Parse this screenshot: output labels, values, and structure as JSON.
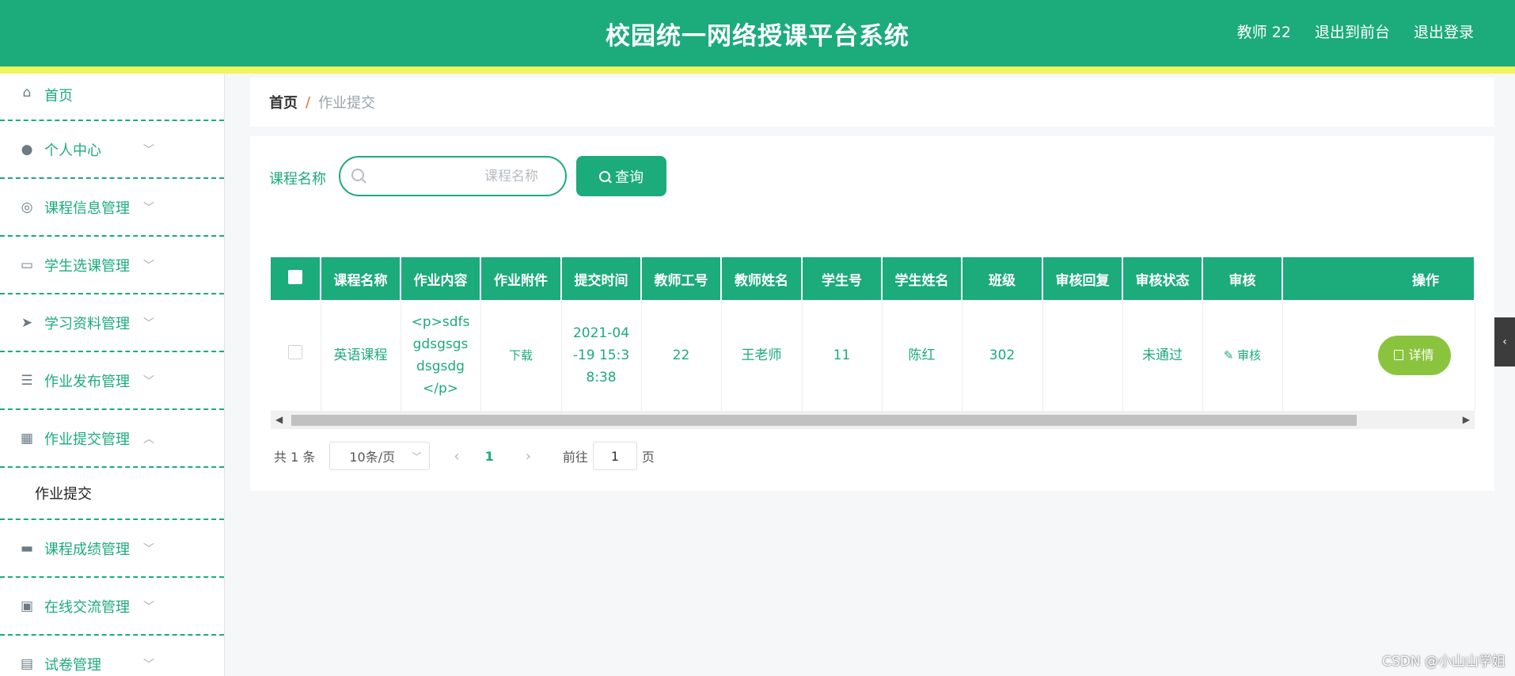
{
  "header": {
    "title": "校园统一网络授课平台系统",
    "user": "教师 22",
    "to_front": "退出到前台",
    "logout": "退出登录"
  },
  "sidebar": {
    "items": [
      {
        "label": "首页",
        "icon": "home-icon"
      },
      {
        "label": "个人中心",
        "icon": "user-icon"
      },
      {
        "label": "课程信息管理",
        "icon": "help-circle-icon"
      },
      {
        "label": "学生选课管理",
        "icon": "chat-icon"
      },
      {
        "label": "学习资料管理",
        "icon": "send-icon"
      },
      {
        "label": "作业发布管理",
        "icon": "sliders-icon"
      },
      {
        "label": "作业提交管理",
        "icon": "grid-icon"
      },
      {
        "label": "课程成绩管理",
        "icon": "tray-icon"
      },
      {
        "label": "在线交流管理",
        "icon": "clipboard-icon"
      },
      {
        "label": "试卷管理",
        "icon": "briefcase-icon"
      }
    ],
    "sub_item": "作业提交"
  },
  "breadcrumb": {
    "home": "首页",
    "sep": "/",
    "current": "作业提交"
  },
  "search": {
    "label": "课程名称",
    "placeholder": "课程名称",
    "button": "查询"
  },
  "table": {
    "columns": [
      "课程名称",
      "作业内容",
      "作业附件",
      "提交时间",
      "教师工号",
      "教师姓名",
      "学生号",
      "学生姓名",
      "班级",
      "审核回复",
      "审核状态",
      "审核",
      "操作"
    ],
    "rows": [
      {
        "course": "英语课程",
        "content": "<p>sdfsgdsgsgsdsgsdg</p>",
        "attachment": "下载",
        "time": "2021-04-19 15:38:38",
        "teacher_id": "22",
        "teacher_name": "王老师",
        "student_id": "11",
        "student_name": "陈红",
        "class": "302",
        "reply": "",
        "status": "未通过",
        "audit": "审核",
        "action": "详情"
      }
    ]
  },
  "pagination": {
    "total": "共 1 条",
    "page_size": "10条/页",
    "current_page": "1",
    "goto_label": "前往",
    "goto_value": "1",
    "page_unit": "页"
  },
  "watermark": "CSDN @小山山学姐",
  "colors": {
    "primary": "#1cab7a",
    "stripe": "#f0f55c",
    "detail_button": "#8ac43f"
  }
}
